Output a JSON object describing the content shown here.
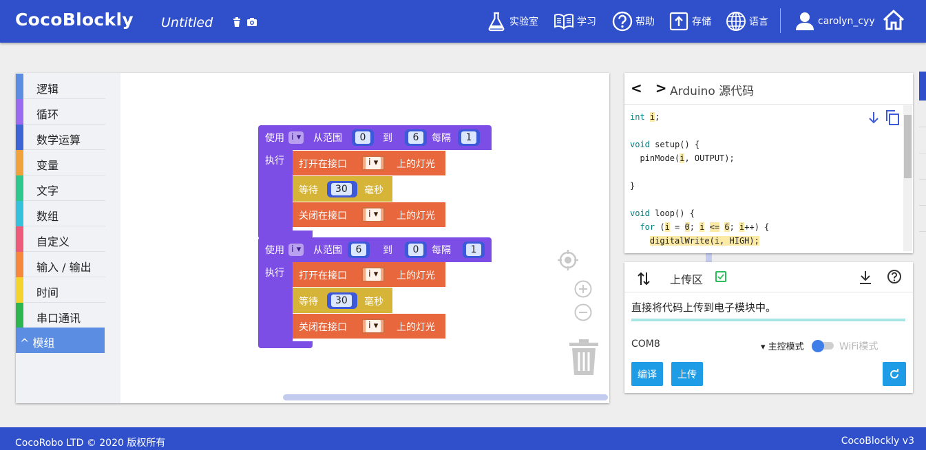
{
  "header": {
    "brand": "CocoBlockly",
    "doc_title": "Untitled",
    "nav": {
      "lab": "实验室",
      "learn": "学习",
      "help": "帮助",
      "storage": "存储",
      "language": "语言",
      "user": "carolyn_cyy"
    }
  },
  "toolbox": {
    "items": [
      {
        "label": "逻辑",
        "color": "#5b8de3"
      },
      {
        "label": "循环",
        "color": "#9b6af0"
      },
      {
        "label": "数学运算",
        "color": "#3e63d4"
      },
      {
        "label": "变量",
        "color": "#f2a23a"
      },
      {
        "label": "文字",
        "color": "#2ec78d"
      },
      {
        "label": "数组",
        "color": "#35c1dc"
      },
      {
        "label": "自定义",
        "color": "#ed5a7a"
      },
      {
        "label": "输入 / 输出",
        "color": "#f7873b"
      },
      {
        "label": "时间",
        "color": "#f4d42a"
      },
      {
        "label": "串口通讯",
        "color": "#2db54f"
      }
    ],
    "selected": "^ 模组"
  },
  "blocks": {
    "loops": [
      {
        "use": "使用",
        "var": "i ▾",
        "from": "从范围",
        "start": "0",
        "to": "到",
        "end": "6",
        "every": "每隔",
        "step": "1",
        "do": "执行",
        "on": {
          "prefix": "打开在接口",
          "var": "i ▾",
          "suffix": "上的灯光"
        },
        "wait": {
          "prefix": "等待",
          "value": "30",
          "unit": "毫秒"
        },
        "off": {
          "prefix": "关闭在接口",
          "var": "i ▾",
          "suffix": "上的灯光"
        }
      },
      {
        "use": "使用",
        "var": "i ▾",
        "from": "从范围",
        "start": "6",
        "to": "到",
        "end": "0",
        "every": "每隔",
        "step": "1",
        "do": "执行",
        "on": {
          "prefix": "打开在接口",
          "var": "i ▾",
          "suffix": "上的灯光"
        },
        "wait": {
          "prefix": "等待",
          "value": "30",
          "unit": "毫秒"
        },
        "off": {
          "prefix": "关闭在接口",
          "var": "i ▾",
          "suffix": "上的灯光"
        }
      }
    ]
  },
  "code_panel": {
    "nav": "< >",
    "title": "Arduino 源代码",
    "lines": {
      "l1_kw": "int",
      "l1_var": "i",
      "l1_end": ";",
      "l3_kw": "void",
      "l3_rest": " setup() {",
      "l4_a": "  pinMode(",
      "l4_var": "i",
      "l4_b": ", OUTPUT);",
      "l6": "}",
      "l8_kw": "void",
      "l8_rest": " loop() {",
      "l9_a": "  ",
      "l9_kw": "for",
      "l9_b": " (",
      "l9_c": "i",
      "l9_d": " = ",
      "l9_e": "0",
      "l9_f": "; ",
      "l9_g": "i",
      "l9_h": " ",
      "l9_i": "<=",
      "l9_j": " ",
      "l9_k": "6",
      "l9_l": "; ",
      "l9_m": "i",
      "l9_n": "++) {",
      "l10_a": "    ",
      "l10_b": "digitalWrite(i, HIGH);"
    }
  },
  "upload_panel": {
    "title": "上传区",
    "description": "直接将代码上传到电子模块中。",
    "port": "COM8",
    "mode_main": "▾ 主控模式",
    "mode_wifi": "WiFi模式",
    "compile": "编译",
    "upload": "上传"
  },
  "footer": {
    "left": "CocoRobo LTD © 2020 版权所有",
    "right": "CocoBlockly v3"
  },
  "colors": {
    "header": "#2f4fcb",
    "loop_block": "#7d4ee6",
    "io_block": "#e8673c",
    "time_block": "#d6b438",
    "button": "#1e9de6"
  }
}
